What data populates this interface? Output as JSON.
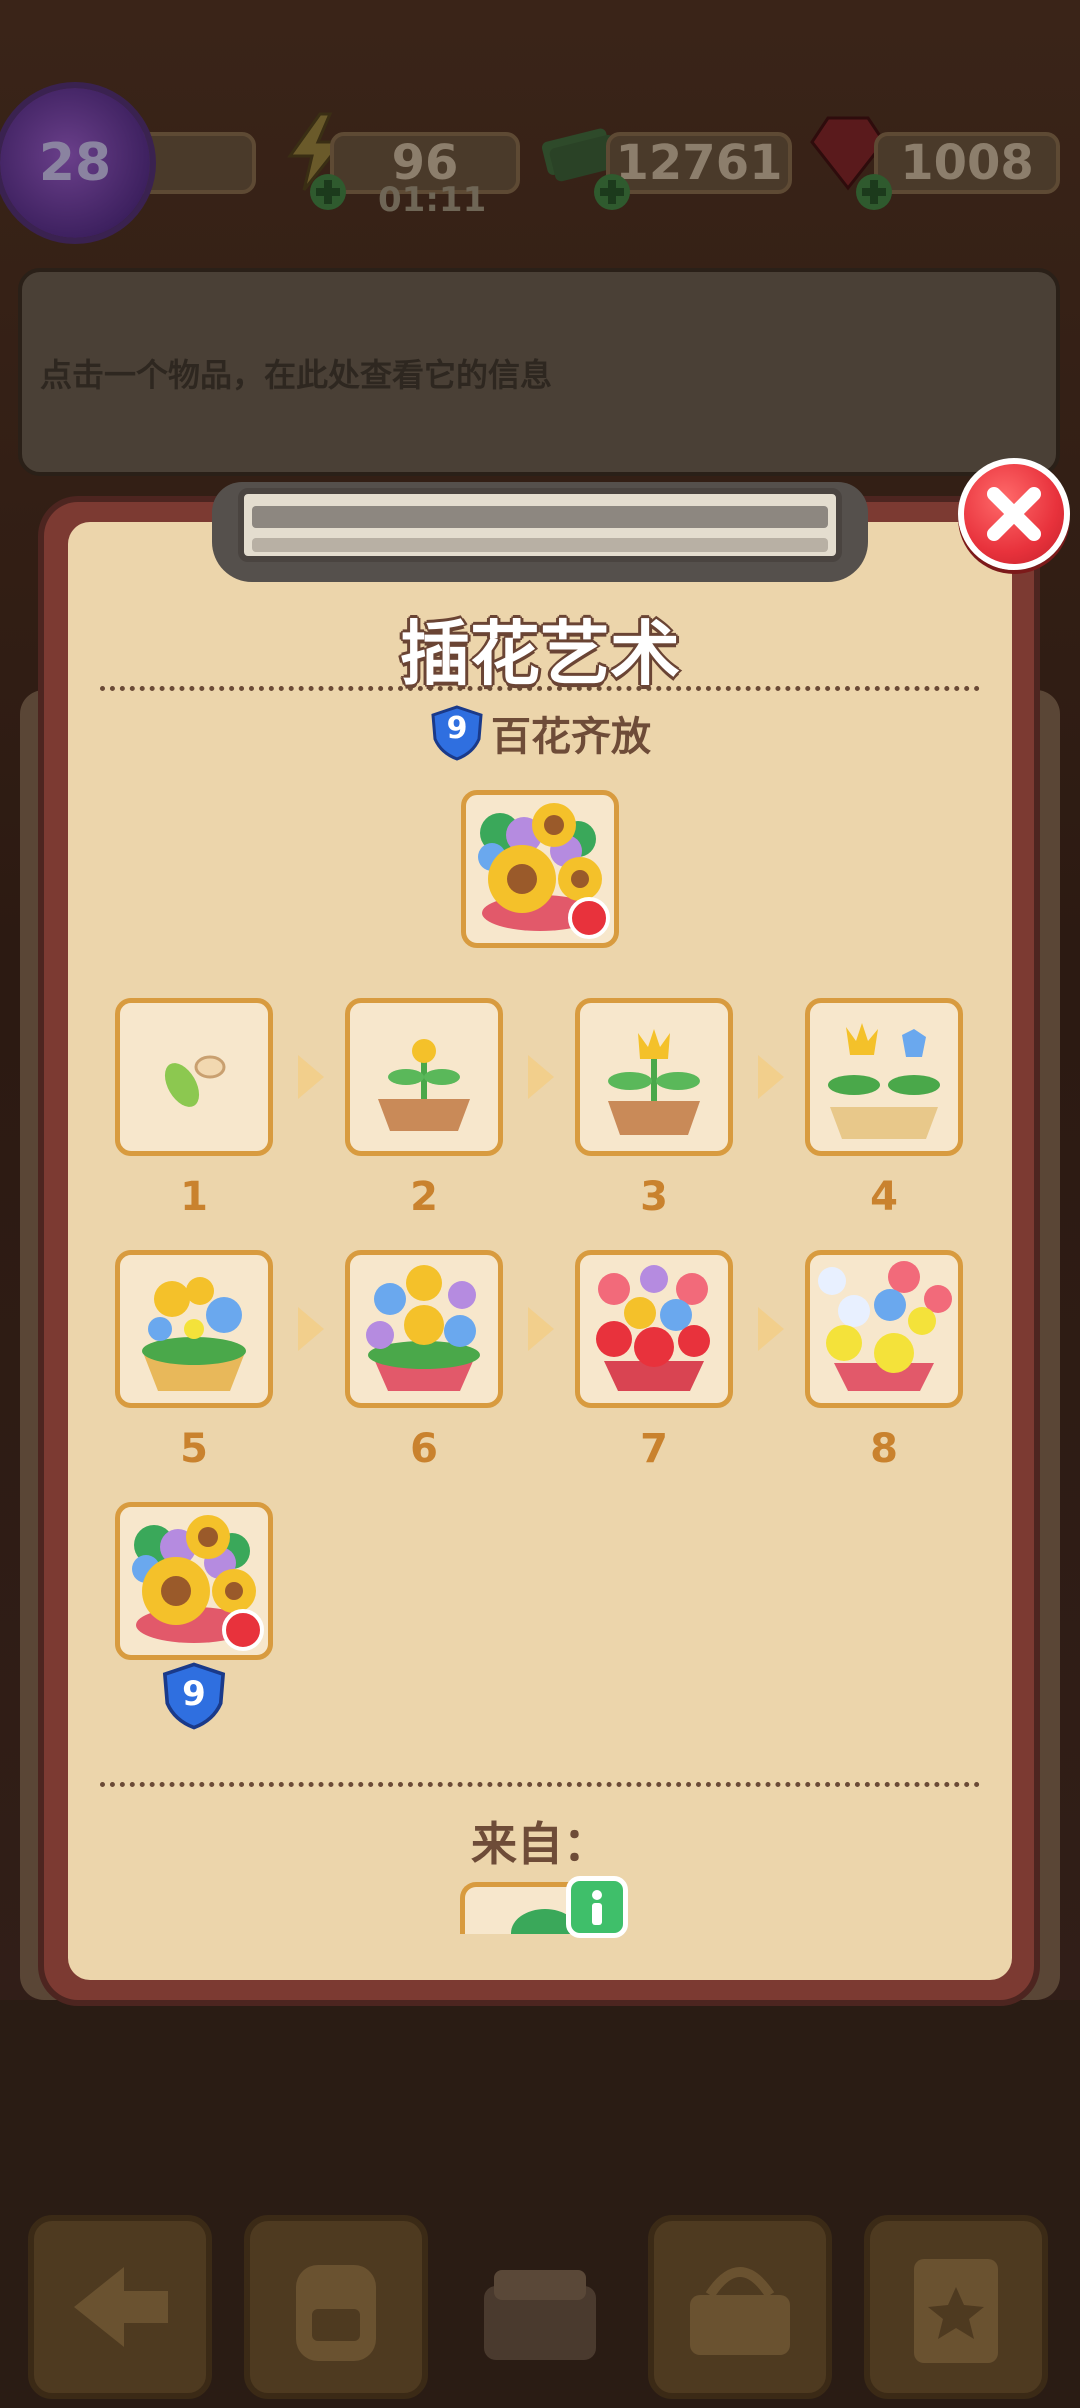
{
  "hud": {
    "level": "28",
    "energy": "96",
    "energy_timer": "01:11",
    "cash": "12761",
    "gems": "1008",
    "icons": [
      "level-badge-icon",
      "energy-bolt-icon",
      "cash-stack-icon",
      "ruby-gem-icon",
      "plus-icon"
    ]
  },
  "info_bar": {
    "hint": "点击一个物品，在此处查看它的信息"
  },
  "dialog": {
    "title": "插花艺术",
    "subtitle": "百花齐放",
    "subtitle_level": "9",
    "chain": [
      {
        "label": "1",
        "icon": "seed-sprout-icon"
      },
      {
        "label": "2",
        "icon": "bud-pot-icon"
      },
      {
        "label": "3",
        "icon": "yellow-flower-pot-icon"
      },
      {
        "label": "4",
        "icon": "flower-planter-icon"
      },
      {
        "label": "5",
        "icon": "flower-basket-icon"
      },
      {
        "label": "6",
        "icon": "mixed-flower-basket-icon"
      },
      {
        "label": "7",
        "icon": "tulip-basket-icon"
      },
      {
        "label": "8",
        "icon": "bouquet-basket-icon"
      },
      {
        "label": "",
        "icon": "sunflower-arrangement-icon"
      }
    ],
    "final_level": "9",
    "from_label": "来自：",
    "close_icon": "close-icon"
  },
  "bottom_bar": {
    "buttons": [
      "back-arrow-icon",
      "backpack-icon",
      "toolbox-icon",
      "basket-icon",
      "clipboard-star-icon"
    ]
  },
  "colors": {
    "accent": "#d89b3f",
    "paper": "#ecd5ab",
    "frame": "#7c3a32",
    "close_red": "#e8323c",
    "shield_blue": "#2f6fe0",
    "info_green": "#3fbf6a"
  }
}
